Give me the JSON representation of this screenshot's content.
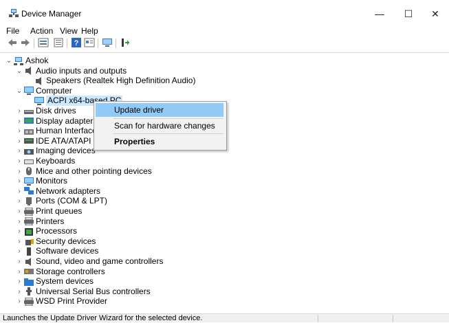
{
  "window": {
    "title": "Device Manager",
    "minimize": "—",
    "maximize": "☐",
    "close": "✕"
  },
  "menu": [
    "File",
    "Action",
    "View",
    "Help"
  ],
  "toolbar": [
    "back-icon",
    "forward-icon",
    "properties-icon",
    "view-icon",
    "help-icon",
    "details-icon",
    "computer-icon",
    "scan-icon"
  ],
  "tree": {
    "root": "Ashok",
    "items": [
      {
        "label": "Audio inputs and outputs",
        "expanded": true,
        "icon": "speaker-icon",
        "children": [
          "Speakers (Realtek High Definition Audio)"
        ]
      },
      {
        "label": "Computer",
        "expanded": true,
        "icon": "monitor-icon",
        "children": [
          "ACPI x64-based PC"
        ]
      },
      {
        "label": "Disk drives",
        "icon": "disk-icon"
      },
      {
        "label": "Display adapters",
        "icon": "display-icon"
      },
      {
        "label": "Human Interface Devices",
        "icon": "hid-icon"
      },
      {
        "label": "IDE ATA/ATAPI controllers",
        "icon": "ide-icon"
      },
      {
        "label": "Imaging devices",
        "icon": "camera-icon"
      },
      {
        "label": "Keyboards",
        "icon": "keyboard-icon"
      },
      {
        "label": "Mice and other pointing devices",
        "icon": "mouse-icon"
      },
      {
        "label": "Monitors",
        "icon": "monitor-icon"
      },
      {
        "label": "Network adapters",
        "icon": "network-icon"
      },
      {
        "label": "Ports (COM & LPT)",
        "icon": "port-icon"
      },
      {
        "label": "Print queues",
        "icon": "printer-icon"
      },
      {
        "label": "Printers",
        "icon": "printer-icon"
      },
      {
        "label": "Processors",
        "icon": "chip-icon"
      },
      {
        "label": "Security devices",
        "icon": "security-icon"
      },
      {
        "label": "Software devices",
        "icon": "software-icon"
      },
      {
        "label": "Sound, video and game controllers",
        "icon": "speaker-icon"
      },
      {
        "label": "Storage controllers",
        "icon": "storage-icon"
      },
      {
        "label": "System devices",
        "icon": "folder-icon"
      },
      {
        "label": "Universal Serial Bus controllers",
        "icon": "usb-icon"
      },
      {
        "label": "WSD Print Provider",
        "icon": "printer-icon"
      }
    ]
  },
  "context_menu": {
    "update": "Update driver",
    "scan": "Scan for hardware changes",
    "properties": "Properties"
  },
  "status": "Launches the Update Driver Wizard for the selected device.",
  "colors": {
    "selection": "#cce8ff",
    "menu_highlight": "#91c9f7",
    "menu_bg": "#f2f2f2"
  }
}
